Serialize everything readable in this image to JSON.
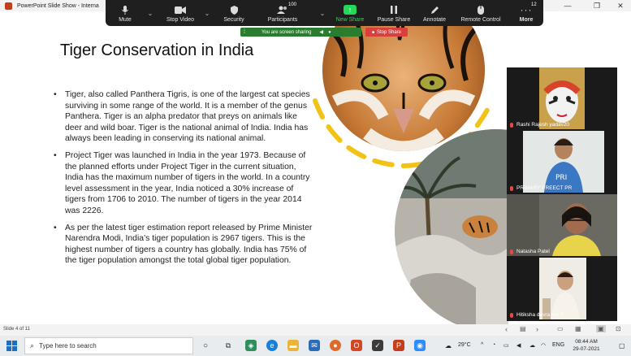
{
  "window": {
    "title": "PowerPoint Slide Show - Interna",
    "controls": [
      "—",
      "❒",
      "✕"
    ]
  },
  "zoom_toolbar": {
    "items": [
      {
        "label": "Mute",
        "icon": "mic-icon"
      },
      {
        "label": "Stop Video",
        "icon": "video-icon"
      },
      {
        "label": "Security",
        "icon": "shield-icon"
      },
      {
        "label": "Participants",
        "icon": "participants-icon",
        "count": "100"
      },
      {
        "label": "New Share",
        "icon": "share-arrow-icon"
      },
      {
        "label": "Pause Share",
        "icon": "pause-icon"
      },
      {
        "label": "Annotate",
        "icon": "pen-icon"
      },
      {
        "label": "Remote Control",
        "icon": "mouse-icon"
      },
      {
        "label": "More",
        "icon": "more-icon",
        "count": "12"
      }
    ],
    "colors": {
      "background": "#1f1f1f",
      "new_share": "#23d959"
    }
  },
  "sharing": {
    "status": "You are screen sharing",
    "stop_label": "Stop Share",
    "stop_icon": "■"
  },
  "slide": {
    "title": "Tiger Conservation in India",
    "bullets": [
      "Tiger, also called Panthera Tigris, is one of the largest cat species surviving in some range of the world. It is a member of the genus Panthera. Tiger is an alpha predator that preys on animals like deer and wild boar. Tiger is the national animal of India. India has always been leading in conserving its national animal.",
      "Project Tiger was launched in India in the year 1973. Because of the planned efforts under Project Tiger in the current situation, India has the maximum number of tigers in the world. In a country level assessment in the year, India noticed a 30% increase of tigers from 1706 to 2010. The number of tigers in the year 2014 was 2226.",
      "As per the latest tiger estimation report released by Prime Minister Narendra Modi, India’s tiger population is 2967 tigers. This is the highest number of tigers a country has globally. India has 75% of the tiger population amongst the total global tiger population."
    ]
  },
  "participants": [
    {
      "name": "Rashi Rajesh yadav20"
    },
    {
      "name": "PRIMARY PREECT PR"
    },
    {
      "name": "Natasha Patel"
    },
    {
      "name": "Hitiksha devra std 2"
    }
  ],
  "statusbar": {
    "slide_info": "Slide 4 of 11"
  },
  "taskbar": {
    "search_placeholder": "Type here to search",
    "weather": "29°C",
    "language": "ENG",
    "time": "08:44 AM",
    "date": "29-07-2021"
  }
}
